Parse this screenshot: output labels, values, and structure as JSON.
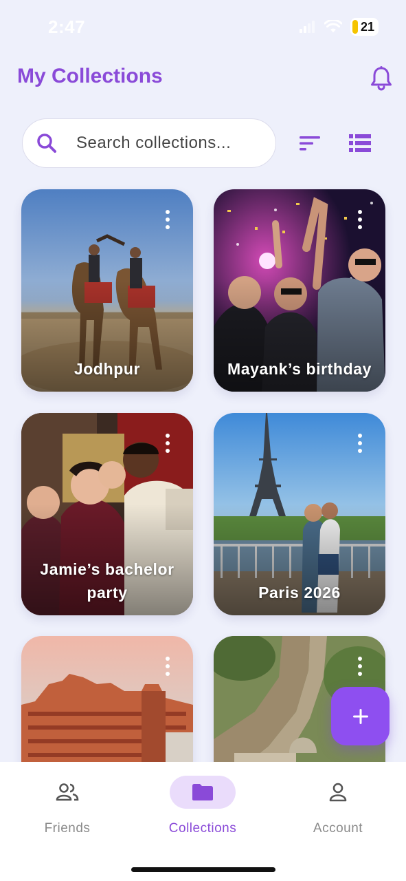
{
  "status_bar": {
    "time": "2:47",
    "battery": "21",
    "icons": [
      "signal-icon",
      "wifi-icon",
      "battery-icon"
    ]
  },
  "header": {
    "title": "My Collections",
    "icons": [
      "bell-icon"
    ]
  },
  "search": {
    "placeholder": "Search collections...",
    "value": ""
  },
  "toolbar": {
    "icons": [
      "sort-icon",
      "list-view-icon"
    ]
  },
  "collections": [
    {
      "title": "Jodhpur",
      "icon": "more-vertical-icon"
    },
    {
      "title": "Mayank’s birthday",
      "icon": "more-vertical-icon"
    },
    {
      "title": "Jamie’s bachelor party",
      "icon": "more-vertical-icon"
    },
    {
      "title": "Paris 2026",
      "icon": "more-vertical-icon"
    },
    {
      "title": "",
      "icon": "more-vertical-icon"
    },
    {
      "title": "",
      "icon": "more-vertical-icon"
    }
  ],
  "fab": {
    "icon": "plus-icon"
  },
  "bottom_nav": {
    "items": [
      {
        "label": "Friends",
        "icon": "people-icon"
      },
      {
        "label": "Collections",
        "icon": "folder-icon",
        "active": true
      },
      {
        "label": "Account",
        "icon": "person-icon"
      }
    ]
  },
  "colors": {
    "accent": "#8a4ad8",
    "fab": "#8e4ff0",
    "background": "#eef0fb",
    "active_nav_pill": "#eadcfb"
  }
}
